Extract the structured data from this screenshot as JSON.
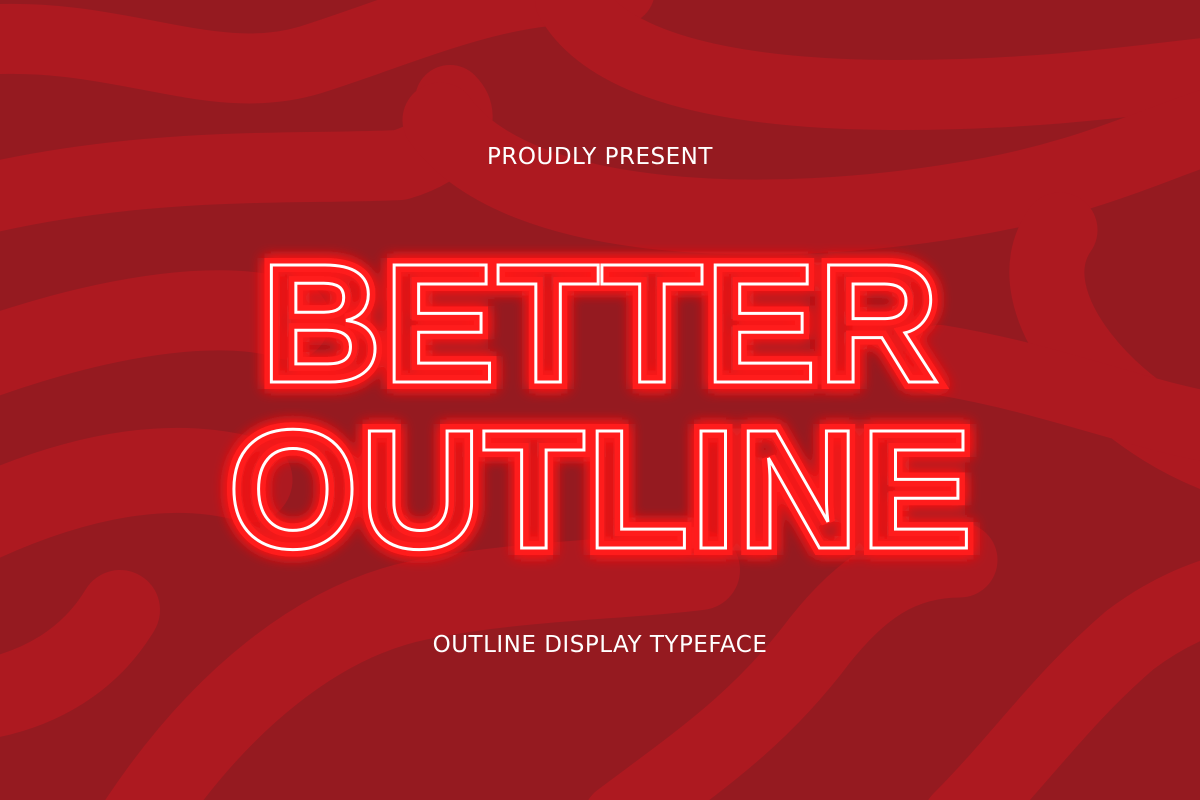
{
  "kicker": "PROUDLY PRESENT",
  "title": {
    "line1": "BETTER",
    "line2": "OUTLINE"
  },
  "subtitle": "OUTLINE DISPLAY TYPEFACE",
  "colors": {
    "background": "#951a20",
    "swirl": "#ad1920",
    "title_glow": "#ff1e1e",
    "title_stroke": "#ffffff",
    "text": "#ffffff"
  }
}
